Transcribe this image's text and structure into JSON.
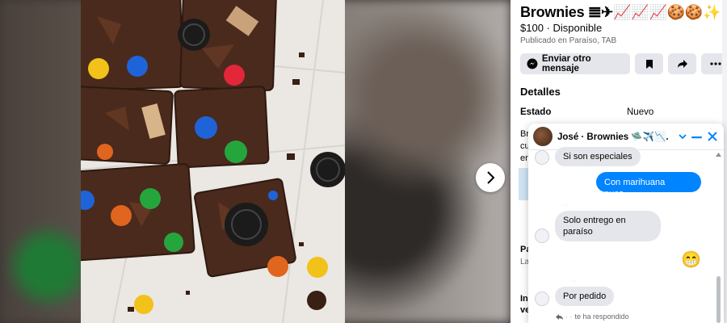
{
  "listing": {
    "title": "Brownies 𝌆✈📈📈📈🍪🍪✨✨",
    "price_status": "$100 · Disponible",
    "location": "Publicado en Paraíso, TAB",
    "send_message_label": "Enviar otro mensaje",
    "details_heading": "Detalles",
    "condition_key": "Estado",
    "condition_value": "Nuevo",
    "peek_lines": [
      "Br",
      "cu",
      "en",
      "Pa",
      "La",
      "In",
      "ve"
    ]
  },
  "chat": {
    "header_name": "José · Brownies 🛸✈️📉...",
    "messages": [
      {
        "from": "them",
        "text": "Si son especiales"
      },
      {
        "from": "me",
        "text": "Con marihuana pues..."
      },
      {
        "from": "them",
        "text": "Solo entrego en paraíso"
      },
      {
        "from": "them",
        "text": "😁"
      },
      {
        "from": "them",
        "text": "Por pedido"
      }
    ],
    "reply_note": "te ha respondido"
  },
  "colors": {
    "messenger_blue": "#0084ff",
    "bubble_gray": "#e4e6eb",
    "panel_bg": "#ffffff"
  },
  "icons": [
    "chevron-right-icon",
    "messenger-icon",
    "bookmark-icon",
    "share-icon",
    "more-icon",
    "chevron-down-icon",
    "minimize-icon",
    "close-icon",
    "reply-icon"
  ]
}
